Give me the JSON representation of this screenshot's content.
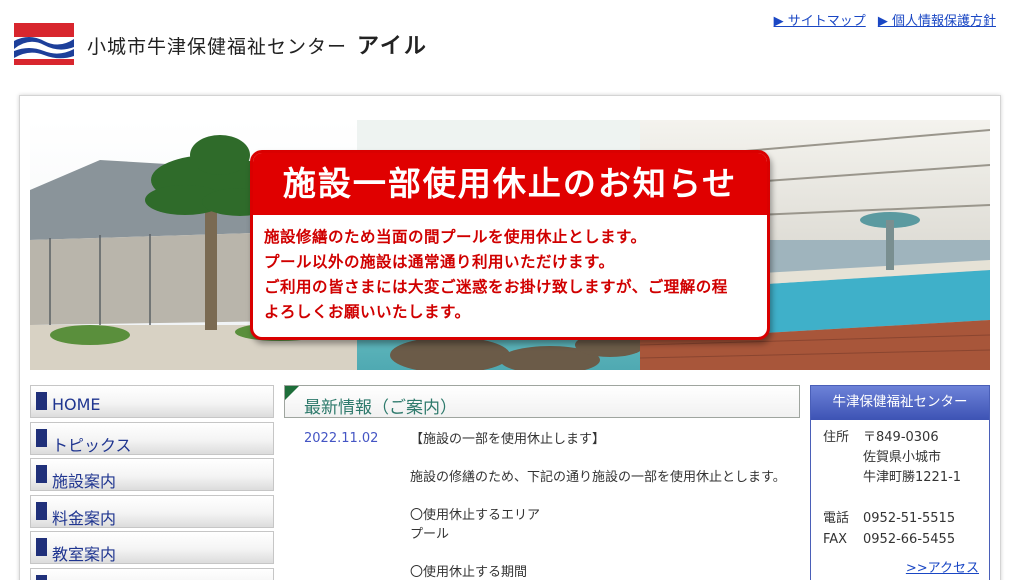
{
  "header": {
    "site_title": "小城市牛津保健福祉センター",
    "site_title_name": "アイル",
    "links": [
      "▶ サイトマップ",
      "▶ 個人情報保護方針"
    ]
  },
  "notice": {
    "title": "施設一部使用休止のお知らせ",
    "lines": [
      "施設修繕のため当面の間プールを使用休止とします。",
      "プール以外の施設は通常通り利用いただけます。",
      "ご利用の皆さまには大変ご迷惑をお掛け致しますが、ご理解の程",
      "よろしくお願いいたします。"
    ]
  },
  "nav": {
    "items": [
      "HOME",
      "トピックス",
      "施設案内",
      "料金案内",
      "教室案内"
    ]
  },
  "news": {
    "title": "最新情報（ご案内）",
    "date": "2022.11.02",
    "lines": [
      "【施設の一部を使用休止します】",
      "",
      "施設の修繕のため、下記の通り施設の一部を使用休止とします。",
      "",
      "〇使用休止するエリア",
      "プール",
      "",
      "〇使用休止する期間"
    ]
  },
  "contact": {
    "title": "牛津保健福祉センター",
    "address_label": "住所",
    "postal": "〒849-0306",
    "address_lines": [
      "佐賀県小城市",
      "牛津町勝1221-1"
    ],
    "phone_label": "電話",
    "phone": "0952-51-5515",
    "fax_label": "FAX",
    "fax": "0952-66-5455",
    "access_link": ">>アクセス"
  },
  "colors": {
    "notice_red": "#e00000",
    "nav_text": "#1f3590",
    "link_blue": "#1a47c4",
    "news_title": "#2e7a6c",
    "contact_header": "#3d53b4"
  }
}
